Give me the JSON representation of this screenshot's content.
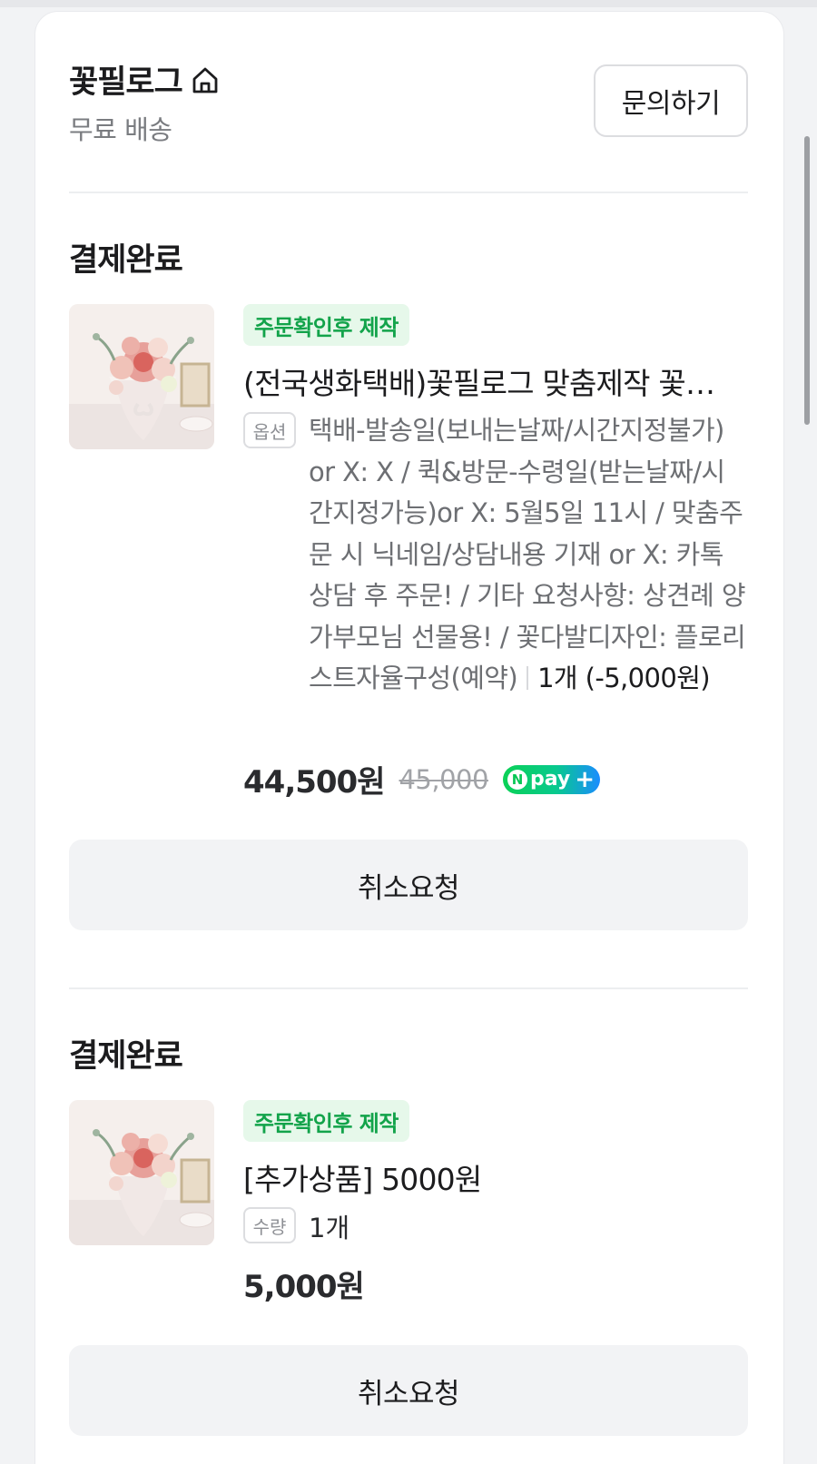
{
  "store": {
    "name": "꽃필로그",
    "shipping": "무료 배송",
    "inquiry_label": "문의하기"
  },
  "orders": [
    {
      "status": "결제완료",
      "badge": "주문확인후 제작",
      "title": "(전국생화택배)꽃필로그 맞춤제작 꽃다발 꽃배달",
      "option_label": "옵션",
      "option_text": "택배-발송일(보내는날짜/시간지정불가) or X: X / 퀵&방문-수령일(받는날짜/시간지정가능)or X: 5월5일 11시 / 맞춤주문 시 닉네임/상담내용 기재 or X: 카톡 상담 후 주문! / 기타 요청사항: 상견례 양가부모님 선물용! / 꽃다발디자인: 플로리스트자율구성(예약)",
      "option_qty": "1개 (-5,000원)",
      "price": "44,500원",
      "original_price": "45,000",
      "npay_label": "pay",
      "cancel_label": "취소요청"
    },
    {
      "status": "결제완료",
      "badge": "주문확인후 제작",
      "title": "[추가상품] 5000원",
      "option_label": "수량",
      "option_text": "1개",
      "price": "5,000원",
      "cancel_label": "취소요청"
    }
  ],
  "colors": {
    "badge_bg": "#e6f8ea",
    "badge_text": "#12a34a",
    "button_bg": "#f2f3f5",
    "npay_green": "#06c755"
  }
}
